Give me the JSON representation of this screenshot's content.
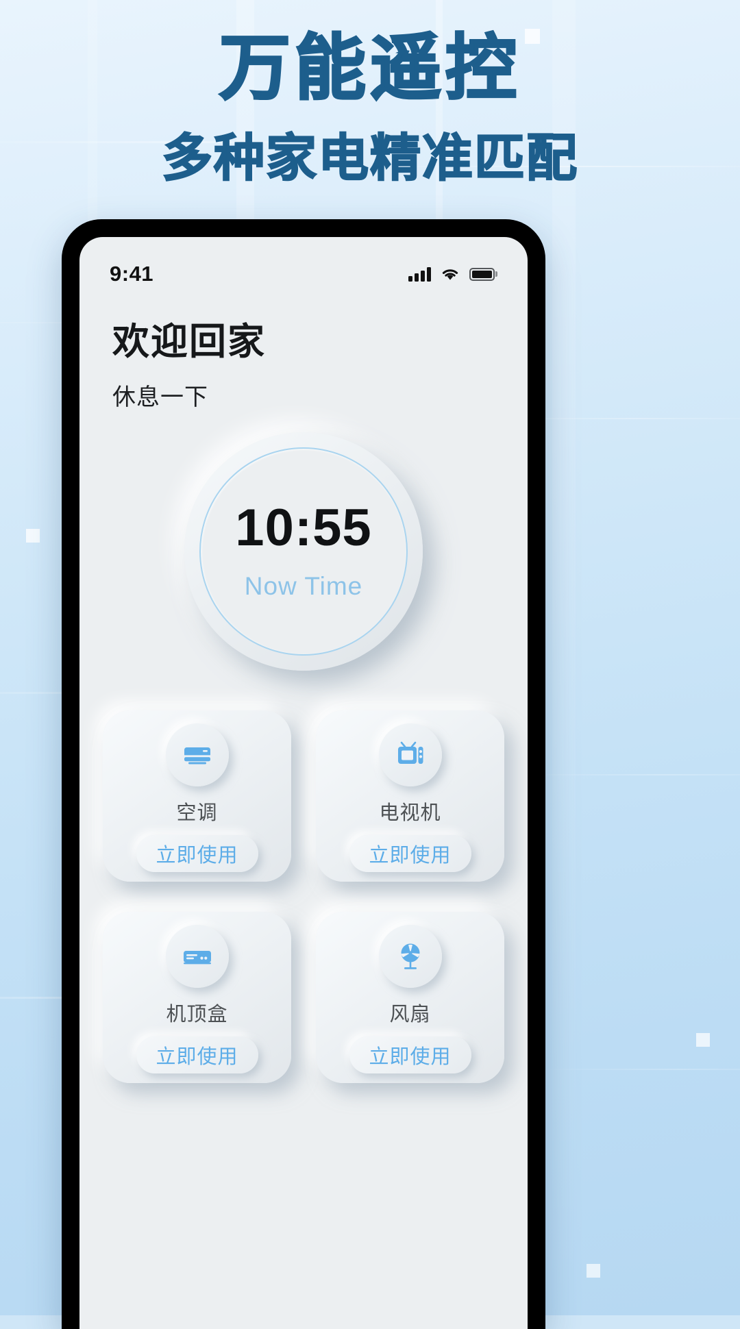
{
  "promo": {
    "title": "万能遥控",
    "subtitle": "多种家电精准匹配",
    "title_color": "#1d5e8c"
  },
  "phone": {
    "status_bar": {
      "time": "9:41",
      "signal_icon": "cellular-signal-icon",
      "wifi_icon": "wifi-icon",
      "battery_icon": "battery-full-icon"
    },
    "greeting": {
      "title": "欢迎回家",
      "subtitle": "休息一下"
    },
    "clock": {
      "time": "10:55",
      "label": "Now Time",
      "label_color": "#8dc3e8",
      "ring_color": "#a9d4ef"
    },
    "devices": {
      "action_label": "立即使用",
      "accent_color": "#5dade8",
      "items": [
        {
          "name": "空调",
          "icon": "air-conditioner-icon",
          "action": "立即使用"
        },
        {
          "name": "电视机",
          "icon": "television-icon",
          "action": "立即使用"
        },
        {
          "name": "机顶盒",
          "icon": "set-top-box-icon",
          "action": "立即使用"
        },
        {
          "name": "风扇",
          "icon": "fan-icon",
          "action": "立即使用"
        }
      ]
    }
  }
}
